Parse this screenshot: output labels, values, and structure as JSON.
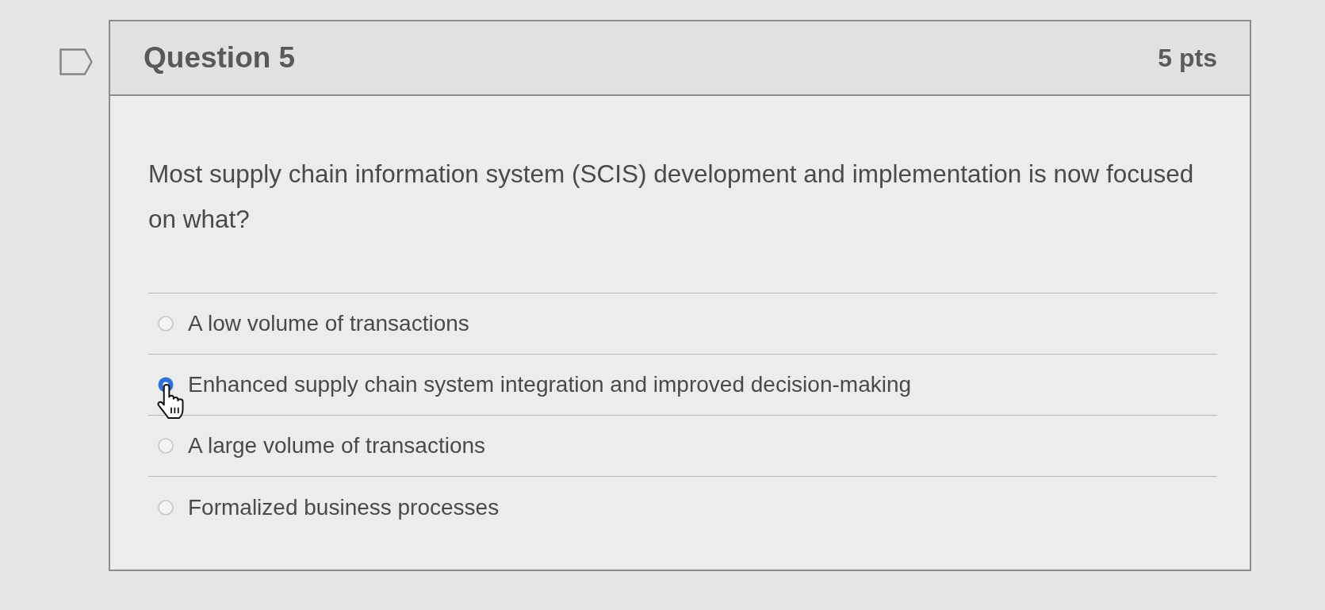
{
  "question": {
    "title": "Question 5",
    "points": "5 pts",
    "text": "Most supply chain information system (SCIS) development and implementation is now focused on what?",
    "answers": [
      {
        "label": "A low volume of transactions",
        "selected": false
      },
      {
        "label": "Enhanced supply chain system integration and improved decision-making",
        "selected": true
      },
      {
        "label": "A large volume of transactions",
        "selected": false
      },
      {
        "label": "Formalized business processes",
        "selected": false
      }
    ]
  }
}
